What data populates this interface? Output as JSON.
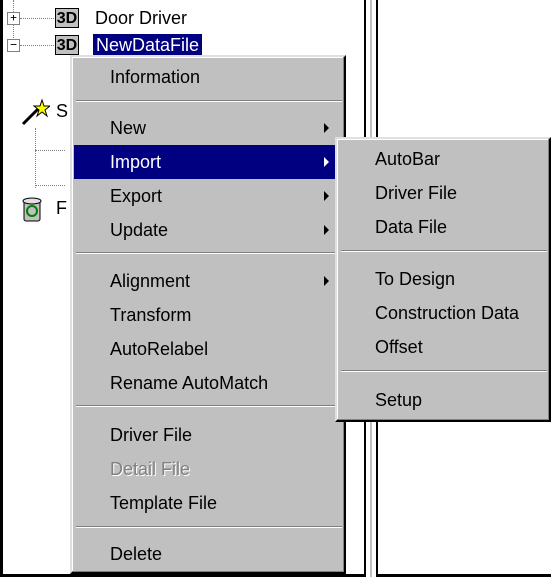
{
  "tree": {
    "item1": {
      "badge": "3D",
      "label": "Door Driver",
      "expander": "+"
    },
    "item2": {
      "badge": "3D",
      "label": "NewDataFile",
      "expander": "−"
    },
    "partial_letters": [
      "S",
      "F"
    ]
  },
  "context_menu": {
    "items": [
      {
        "label": "Information"
      },
      {
        "label": "New"
      },
      {
        "label": "Import"
      },
      {
        "label": "Export"
      },
      {
        "label": "Update"
      },
      {
        "label": "Alignment"
      },
      {
        "label": "Transform"
      },
      {
        "label": "AutoRelabel"
      },
      {
        "label": "Rename AutoMatch"
      },
      {
        "label": "Driver File"
      },
      {
        "label": "Detail File"
      },
      {
        "label": "Template File"
      },
      {
        "label": "Delete"
      }
    ]
  },
  "submenu": {
    "items": [
      {
        "label": "AutoBar"
      },
      {
        "label": "Driver File"
      },
      {
        "label": "Data File"
      },
      {
        "label": "To Design"
      },
      {
        "label": "Construction Data"
      },
      {
        "label": "Offset"
      },
      {
        "label": "Setup"
      }
    ]
  },
  "colors": {
    "menu_bg": "#c0c0c0",
    "highlight": "#000080",
    "disabled": "#808080"
  }
}
